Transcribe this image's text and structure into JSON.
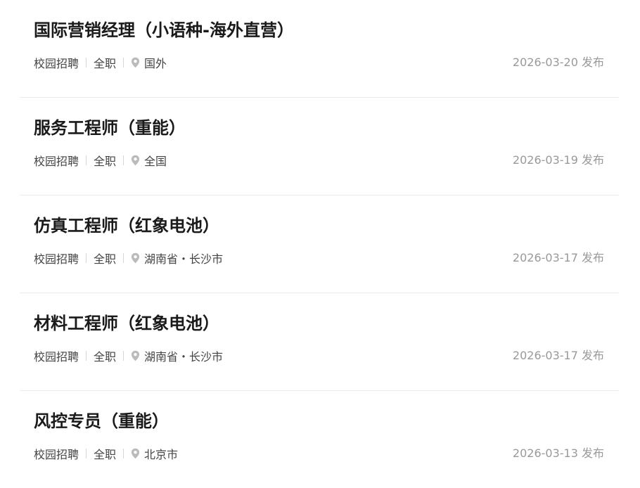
{
  "colors": {
    "title": "#1a1a1a",
    "meta_text": "#444444",
    "date_text": "#999999",
    "divider": "#ebebeb",
    "location_icon": "#bbbbbb"
  },
  "jobs": [
    {
      "title": "国际营销经理（小语种-海外直营）",
      "recruit_type": "校园招聘",
      "employment": "全职",
      "location": "国外",
      "date": "2026-03-20 发布",
      "icon": "location-pin-icon"
    },
    {
      "title": "服务工程师（重能）",
      "recruit_type": "校园招聘",
      "employment": "全职",
      "location": "全国",
      "date": "2026-03-19 发布",
      "icon": "location-pin-icon"
    },
    {
      "title": "仿真工程师（红象电池）",
      "recruit_type": "校园招聘",
      "employment": "全职",
      "location": "湖南省・长沙市",
      "date": "2026-03-17 发布",
      "icon": "location-pin-icon"
    },
    {
      "title": "材料工程师（红象电池）",
      "recruit_type": "校园招聘",
      "employment": "全职",
      "location": "湖南省・长沙市",
      "date": "2026-03-17 发布",
      "icon": "location-pin-icon"
    },
    {
      "title": "风控专员（重能）",
      "recruit_type": "校园招聘",
      "employment": "全职",
      "location": "北京市",
      "date": "2026-03-13 发布",
      "icon": "location-pin-icon"
    }
  ]
}
